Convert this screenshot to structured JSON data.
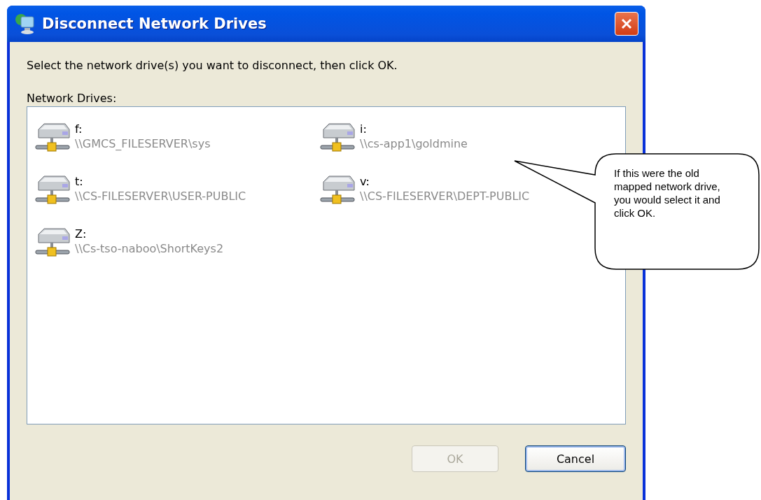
{
  "window": {
    "title": "Disconnect Network Drives"
  },
  "instruction": "Select the network drive(s) you want to disconnect, then click OK.",
  "list_label": "Network Drives:",
  "drives": [
    {
      "letter": "f:",
      "path": "\\\\GMCS_FILESERVER\\sys",
      "selected": false
    },
    {
      "letter": "i:",
      "path": "\\\\cs-app1\\goldmine",
      "selected": false
    },
    {
      "letter": "t:",
      "path": "\\\\CS-FILESERVER\\USER-PUBLIC",
      "selected": false
    },
    {
      "letter": "v:",
      "path": "\\\\CS-FILESERVER\\DEPT-PUBLIC",
      "selected": false
    },
    {
      "letter": "Z:",
      "path": "\\\\Cs-tso-naboo\\ShortKeys2",
      "selected": false
    }
  ],
  "buttons": [
    {
      "label": "OK",
      "disabled": true,
      "default": false
    },
    {
      "label": "Cancel",
      "disabled": false,
      "default": true
    }
  ],
  "callout": {
    "text": "If this were the old mapped network drive, you would select it and click OK."
  }
}
